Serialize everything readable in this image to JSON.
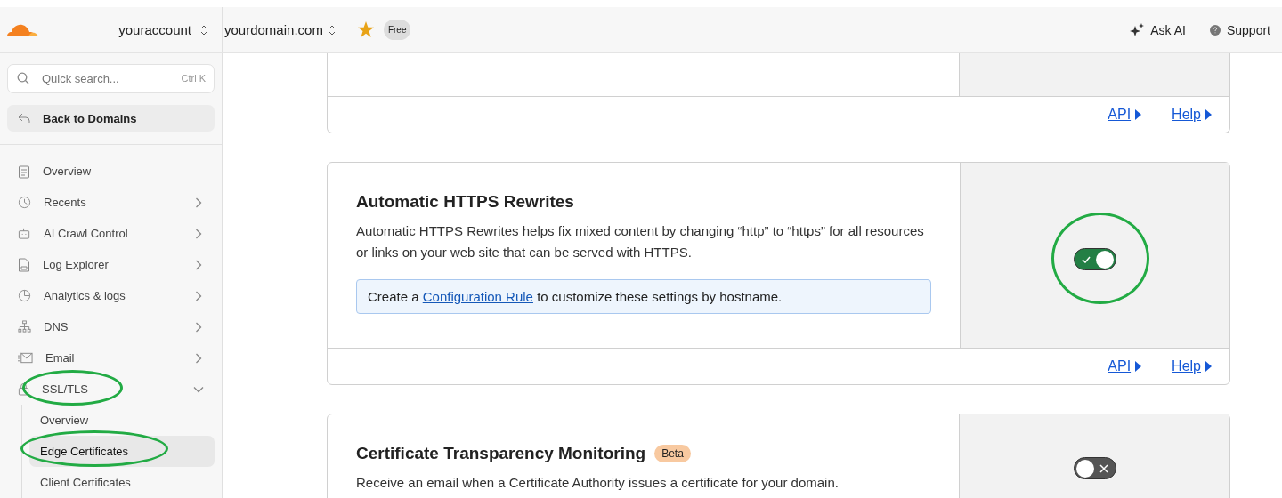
{
  "topbar": {
    "account": "youraccount",
    "domain": "yourdomain.com",
    "starred": true,
    "plan_badge": "Free",
    "actions": [
      {
        "kind": "ai",
        "label": "Ask AI"
      },
      {
        "kind": "support",
        "label": "Support"
      }
    ]
  },
  "sidebar": {
    "search": {
      "placeholder": "Quick search...",
      "shortcut": "Ctrl K"
    },
    "back": "Back to Domains",
    "items": [
      {
        "kind": "link",
        "label": "Overview",
        "selected": false,
        "circled": false
      },
      {
        "kind": "group",
        "label": "Recents",
        "selected": false,
        "expanded": false,
        "circled": false
      },
      {
        "kind": "group",
        "label": "AI Crawl Control",
        "selected": false,
        "expanded": false,
        "circled": false
      },
      {
        "kind": "group",
        "label": "Log Explorer",
        "selected": false,
        "expanded": false,
        "circled": false
      },
      {
        "kind": "group",
        "label": "Analytics & logs",
        "selected": false,
        "expanded": false,
        "circled": false
      },
      {
        "kind": "group",
        "label": "DNS",
        "selected": false,
        "expanded": false,
        "circled": false
      },
      {
        "kind": "group",
        "label": "Email",
        "selected": false,
        "expanded": false,
        "circled": false
      },
      {
        "kind": "group",
        "label": "SSL/TLS",
        "selected": false,
        "expanded": true,
        "circled": true,
        "children": [
          {
            "label": "Overview",
            "selected": false,
            "circled": false
          },
          {
            "label": "Edge Certificates",
            "selected": true,
            "circled": true
          },
          {
            "label": "Client Certificates",
            "selected": false,
            "circled": false
          }
        ]
      }
    ]
  },
  "cards": [
    {
      "kind": "partial",
      "links": [
        "API",
        "Help"
      ]
    },
    {
      "kind": "setting",
      "title": "Automatic HTTPS Rewrites",
      "description": "Automatic HTTPS Rewrites helps fix mixed content by changing “http” to “https” for all resources or links on your web site that can be served with HTTPS.",
      "note": {
        "before": "Create a",
        "link": "Configuration Rule",
        "after": "to customize these settings by hostname."
      },
      "toggle": {
        "on": true,
        "circled": true
      },
      "links": [
        "API",
        "Help"
      ]
    },
    {
      "kind": "setting",
      "title": "Certificate Transparency Monitoring",
      "badge": "Beta",
      "description": "Receive an email when a Certificate Authority issues a certificate for your domain.",
      "toggle": {
        "on": false,
        "circled": false
      }
    }
  ]
}
